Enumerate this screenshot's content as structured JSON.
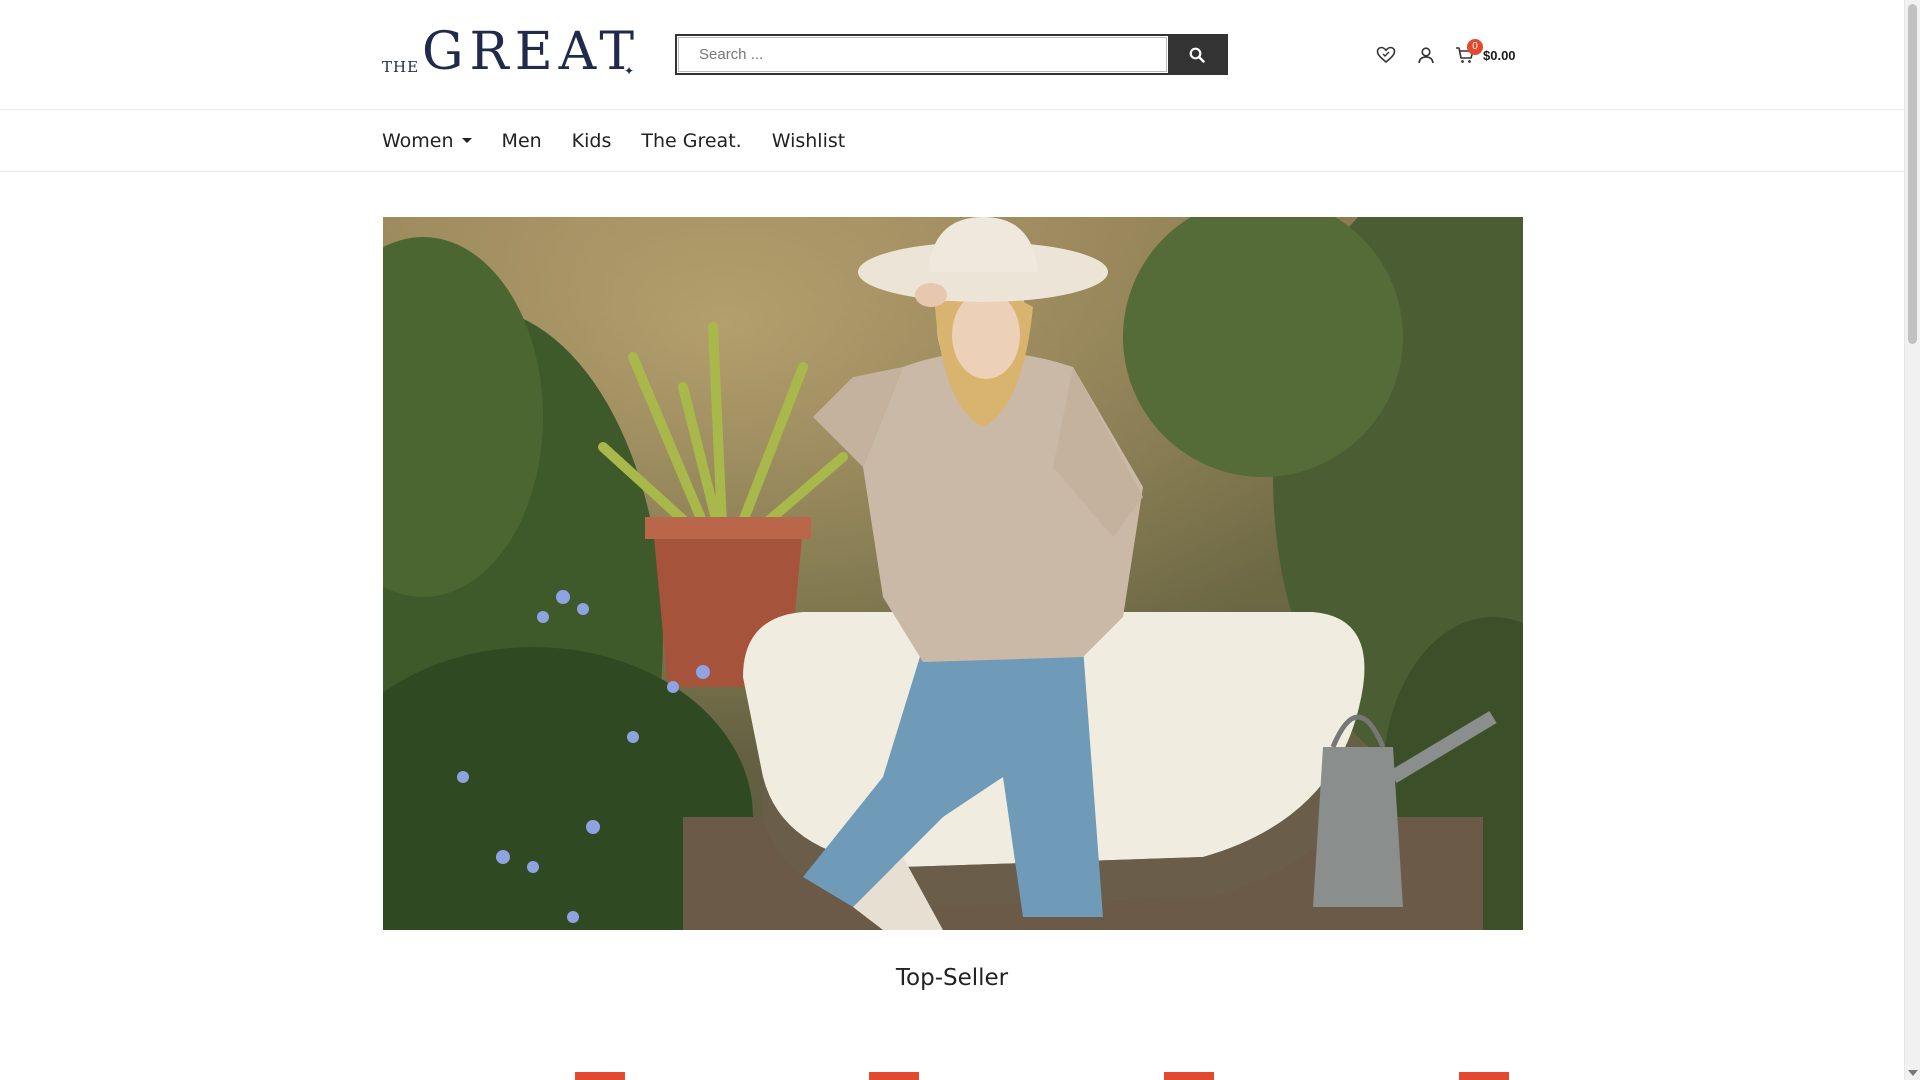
{
  "brand": {
    "the": "THE",
    "great": "GREAT",
    "mark": "✦"
  },
  "search": {
    "placeholder": "Search ..."
  },
  "header": {
    "cart_count": "0",
    "cart_total": "$0.00"
  },
  "nav": {
    "items": [
      {
        "label": "Women",
        "has_dropdown": true
      },
      {
        "label": "Men"
      },
      {
        "label": "Kids"
      },
      {
        "label": "The Great."
      },
      {
        "label": "Wishlist"
      }
    ]
  },
  "section": {
    "title": "Top-Seller"
  },
  "colors": {
    "accent": "#e2492e",
    "brand": "#1f2a4d",
    "dark": "#333333"
  }
}
